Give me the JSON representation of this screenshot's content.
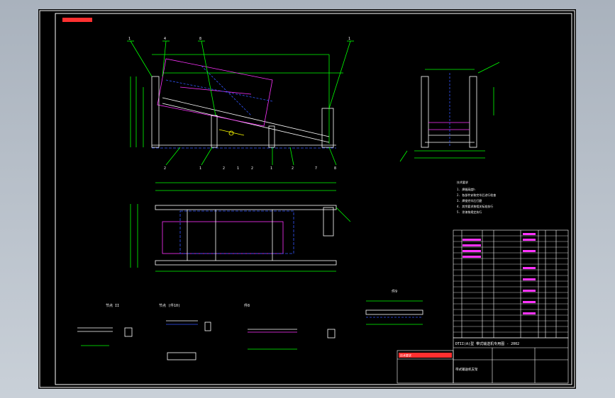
{
  "window": {
    "title": "",
    "background": "#b9c1cb"
  },
  "sheet": {
    "background": "#000000",
    "border": "#ffffff"
  },
  "colors": {
    "outline": "#ffffff",
    "frame": "#00ff00",
    "dim": "#00ff00",
    "part": "#ff33ff",
    "hidden": "#3355ff",
    "note": "#ffff00",
    "red": "#ff3030",
    "table": "#ffffff"
  },
  "views": {
    "side_elevation": {
      "label": "",
      "part_callouts": [
        "1",
        "4",
        "8",
        "1",
        "2",
        "1",
        "2",
        "1",
        "2",
        "1",
        "2",
        "7",
        "8"
      ]
    },
    "end_view": {
      "label": ""
    },
    "plan_view": {
      "label": ""
    },
    "detail_1": {
      "label": "节点 II"
    },
    "detail_2": {
      "label": "节点 (件10)"
    },
    "detail_3": {
      "label": "件8"
    },
    "detail_4": {
      "label": "件9"
    }
  },
  "notes": {
    "heading": "技术要求",
    "lines": [
      "1. 焊缝高度h",
      "2. 各部件安装完毕后进行检查",
      "3. 焊接完毕后打磨",
      "4. 其余要求按相关标准执行",
      "5. 涂漆按规定执行"
    ]
  },
  "title_block": {
    "drawing_title": "DTII(A)型 带式输送机专用图 - 2002",
    "name": "带式输送机支架",
    "stamp": "技术要求"
  },
  "bom": {
    "row_count": 18,
    "columns": 8
  }
}
